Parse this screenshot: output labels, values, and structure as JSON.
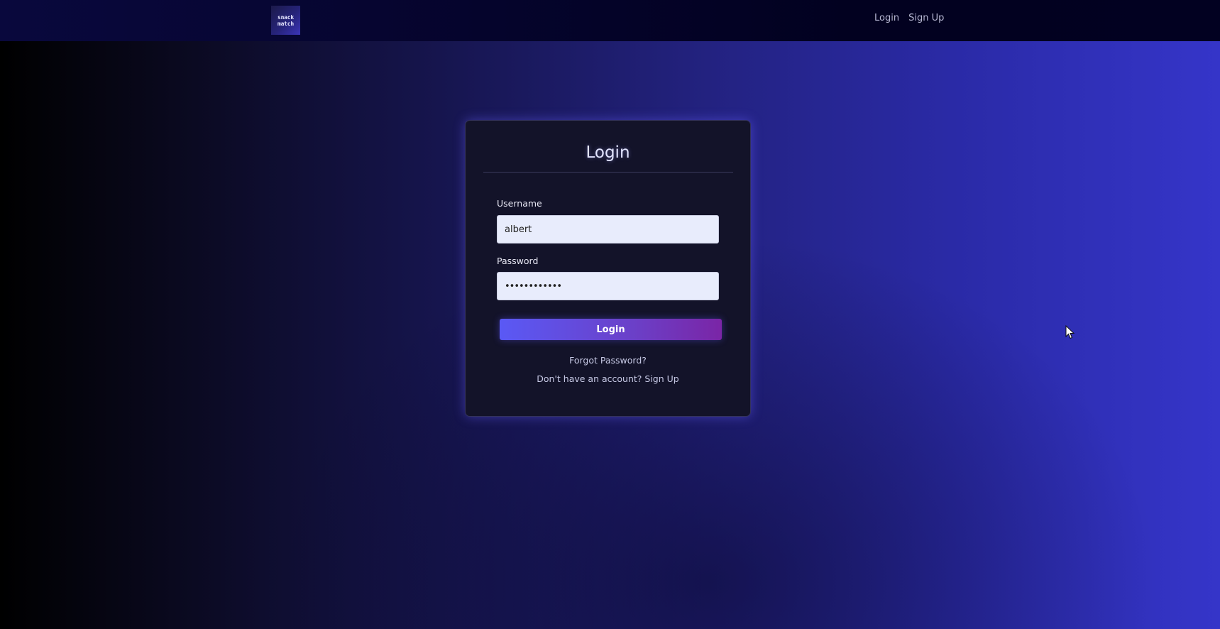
{
  "navbar": {
    "logo_text": "snack\nmatch",
    "links": {
      "login": "Login",
      "signup": "Sign Up"
    }
  },
  "login_form": {
    "title": "Login",
    "username": {
      "label": "Username",
      "value": "albert"
    },
    "password": {
      "label": "Password",
      "value": "••••••••••••"
    },
    "submit_label": "Login",
    "forgot_password": "Forgot Password?",
    "signup_prompt": "Don't have an account?",
    "signup_link": "Sign Up"
  },
  "colors": {
    "accent_start": "#5a59f5",
    "accent_end": "#7a25a6",
    "card_bg": "#131329",
    "navbar_bg": "#05042c"
  }
}
